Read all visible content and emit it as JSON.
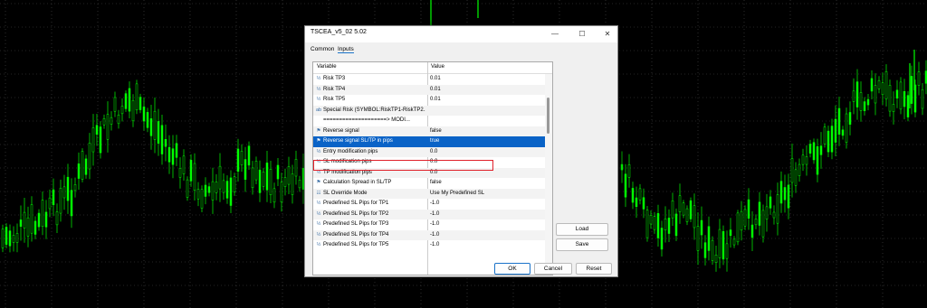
{
  "window": {
    "title": "TSCEA_v5_02 5.02",
    "controls": [
      "—",
      "☐",
      "✕"
    ]
  },
  "tabs": [
    {
      "label": "Common",
      "active": false
    },
    {
      "label": "Inputs",
      "active": true
    }
  ],
  "grid": {
    "headers": {
      "variable": "Variable",
      "value": "Value"
    },
    "rows": [
      {
        "icon": "½",
        "name": "Risk TP3",
        "value": "0.01"
      },
      {
        "icon": "½",
        "name": "Risk TP4",
        "value": "0.01"
      },
      {
        "icon": "½",
        "name": "Risk TP5",
        "value": "0.01"
      },
      {
        "icon": "ab",
        "name": "Special Risk (SYMBOL:RiskTP1-RiskTP2...",
        "value": ""
      },
      {
        "icon": "",
        "name": "====================> MODI...",
        "value": ""
      },
      {
        "icon": "⚑",
        "name": "Reverse signal",
        "value": "false"
      },
      {
        "icon": "⚑",
        "name": "Reverse signal SL/TP in pips",
        "value": "true",
        "selected": true
      },
      {
        "icon": "½",
        "name": "Entry modification pips",
        "value": "0.0"
      },
      {
        "icon": "½",
        "name": "SL modification pips",
        "value": "0.0"
      },
      {
        "icon": "½",
        "name": "TP modification pips",
        "value": "0.0"
      },
      {
        "icon": "⚑",
        "name": "Calculation Spread in SL/TP",
        "value": "false"
      },
      {
        "icon": "☷",
        "name": "SL Override Mode",
        "value": "Use My Predefined SL"
      },
      {
        "icon": "½",
        "name": "Predefined SL Pips for TP1",
        "value": "-1.0"
      },
      {
        "icon": "½",
        "name": "Predefined SL Pips for TP2",
        "value": "-1.0"
      },
      {
        "icon": "½",
        "name": "Predefined SL Pips for TP3",
        "value": "-1.0"
      },
      {
        "icon": "½",
        "name": "Predefined SL Pips for TP4",
        "value": "-1.0"
      },
      {
        "icon": "½",
        "name": "Predefined SL Pips for TP5",
        "value": "-1.0"
      }
    ]
  },
  "side_buttons": {
    "load": "Load",
    "save": "Save"
  },
  "bottom_buttons": {
    "ok": "OK",
    "cancel": "Cancel",
    "reset": "Reset"
  },
  "colors": {
    "chart_bg": "#000000",
    "candles": "#00ff00",
    "grid": "#4a4a4a",
    "selection": "#0a63c7",
    "highlight": "#e0202a"
  }
}
